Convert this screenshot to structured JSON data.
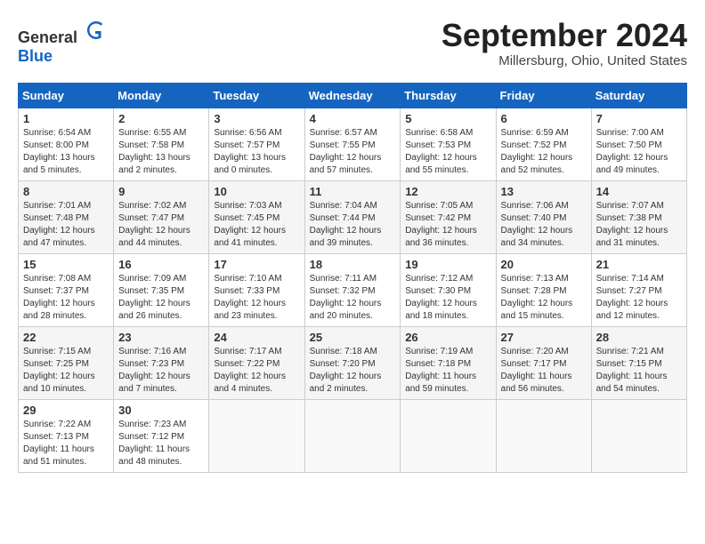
{
  "header": {
    "logo_general": "General",
    "logo_blue": "Blue",
    "month_title": "September 2024",
    "location": "Millersburg, Ohio, United States"
  },
  "weekdays": [
    "Sunday",
    "Monday",
    "Tuesday",
    "Wednesday",
    "Thursday",
    "Friday",
    "Saturday"
  ],
  "weeks": [
    [
      {
        "day": "1",
        "info": "Sunrise: 6:54 AM\nSunset: 8:00 PM\nDaylight: 13 hours\nand 5 minutes."
      },
      {
        "day": "2",
        "info": "Sunrise: 6:55 AM\nSunset: 7:58 PM\nDaylight: 13 hours\nand 2 minutes."
      },
      {
        "day": "3",
        "info": "Sunrise: 6:56 AM\nSunset: 7:57 PM\nDaylight: 13 hours\nand 0 minutes."
      },
      {
        "day": "4",
        "info": "Sunrise: 6:57 AM\nSunset: 7:55 PM\nDaylight: 12 hours\nand 57 minutes."
      },
      {
        "day": "5",
        "info": "Sunrise: 6:58 AM\nSunset: 7:53 PM\nDaylight: 12 hours\nand 55 minutes."
      },
      {
        "day": "6",
        "info": "Sunrise: 6:59 AM\nSunset: 7:52 PM\nDaylight: 12 hours\nand 52 minutes."
      },
      {
        "day": "7",
        "info": "Sunrise: 7:00 AM\nSunset: 7:50 PM\nDaylight: 12 hours\nand 49 minutes."
      }
    ],
    [
      {
        "day": "8",
        "info": "Sunrise: 7:01 AM\nSunset: 7:48 PM\nDaylight: 12 hours\nand 47 minutes."
      },
      {
        "day": "9",
        "info": "Sunrise: 7:02 AM\nSunset: 7:47 PM\nDaylight: 12 hours\nand 44 minutes."
      },
      {
        "day": "10",
        "info": "Sunrise: 7:03 AM\nSunset: 7:45 PM\nDaylight: 12 hours\nand 41 minutes."
      },
      {
        "day": "11",
        "info": "Sunrise: 7:04 AM\nSunset: 7:44 PM\nDaylight: 12 hours\nand 39 minutes."
      },
      {
        "day": "12",
        "info": "Sunrise: 7:05 AM\nSunset: 7:42 PM\nDaylight: 12 hours\nand 36 minutes."
      },
      {
        "day": "13",
        "info": "Sunrise: 7:06 AM\nSunset: 7:40 PM\nDaylight: 12 hours\nand 34 minutes."
      },
      {
        "day": "14",
        "info": "Sunrise: 7:07 AM\nSunset: 7:38 PM\nDaylight: 12 hours\nand 31 minutes."
      }
    ],
    [
      {
        "day": "15",
        "info": "Sunrise: 7:08 AM\nSunset: 7:37 PM\nDaylight: 12 hours\nand 28 minutes."
      },
      {
        "day": "16",
        "info": "Sunrise: 7:09 AM\nSunset: 7:35 PM\nDaylight: 12 hours\nand 26 minutes."
      },
      {
        "day": "17",
        "info": "Sunrise: 7:10 AM\nSunset: 7:33 PM\nDaylight: 12 hours\nand 23 minutes."
      },
      {
        "day": "18",
        "info": "Sunrise: 7:11 AM\nSunset: 7:32 PM\nDaylight: 12 hours\nand 20 minutes."
      },
      {
        "day": "19",
        "info": "Sunrise: 7:12 AM\nSunset: 7:30 PM\nDaylight: 12 hours\nand 18 minutes."
      },
      {
        "day": "20",
        "info": "Sunrise: 7:13 AM\nSunset: 7:28 PM\nDaylight: 12 hours\nand 15 minutes."
      },
      {
        "day": "21",
        "info": "Sunrise: 7:14 AM\nSunset: 7:27 PM\nDaylight: 12 hours\nand 12 minutes."
      }
    ],
    [
      {
        "day": "22",
        "info": "Sunrise: 7:15 AM\nSunset: 7:25 PM\nDaylight: 12 hours\nand 10 minutes."
      },
      {
        "day": "23",
        "info": "Sunrise: 7:16 AM\nSunset: 7:23 PM\nDaylight: 12 hours\nand 7 minutes."
      },
      {
        "day": "24",
        "info": "Sunrise: 7:17 AM\nSunset: 7:22 PM\nDaylight: 12 hours\nand 4 minutes."
      },
      {
        "day": "25",
        "info": "Sunrise: 7:18 AM\nSunset: 7:20 PM\nDaylight: 12 hours\nand 2 minutes."
      },
      {
        "day": "26",
        "info": "Sunrise: 7:19 AM\nSunset: 7:18 PM\nDaylight: 11 hours\nand 59 minutes."
      },
      {
        "day": "27",
        "info": "Sunrise: 7:20 AM\nSunset: 7:17 PM\nDaylight: 11 hours\nand 56 minutes."
      },
      {
        "day": "28",
        "info": "Sunrise: 7:21 AM\nSunset: 7:15 PM\nDaylight: 11 hours\nand 54 minutes."
      }
    ],
    [
      {
        "day": "29",
        "info": "Sunrise: 7:22 AM\nSunset: 7:13 PM\nDaylight: 11 hours\nand 51 minutes."
      },
      {
        "day": "30",
        "info": "Sunrise: 7:23 AM\nSunset: 7:12 PM\nDaylight: 11 hours\nand 48 minutes."
      },
      {
        "day": "",
        "info": ""
      },
      {
        "day": "",
        "info": ""
      },
      {
        "day": "",
        "info": ""
      },
      {
        "day": "",
        "info": ""
      },
      {
        "day": "",
        "info": ""
      }
    ]
  ]
}
